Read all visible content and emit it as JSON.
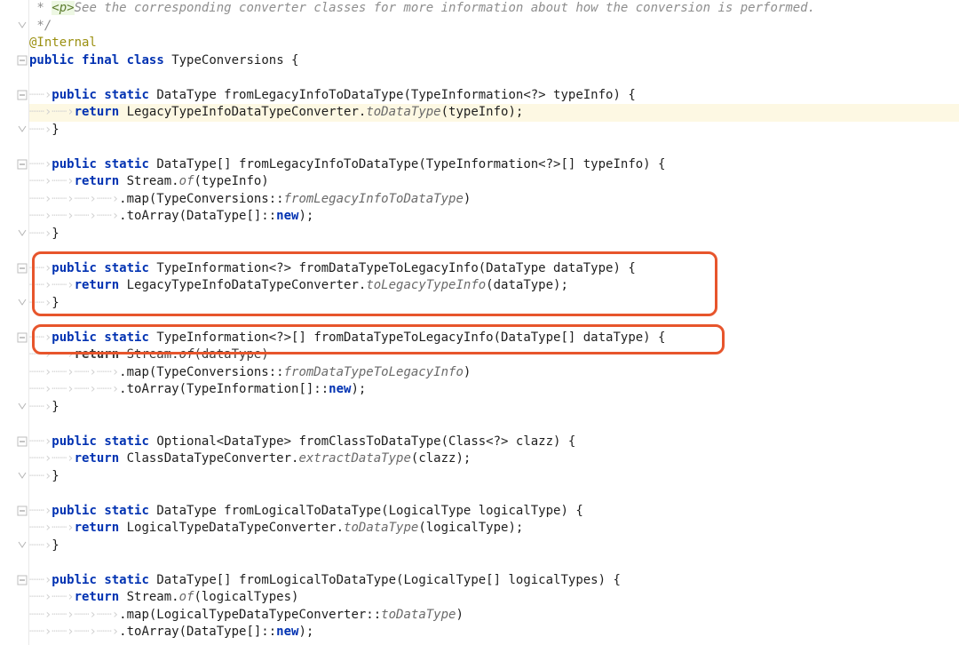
{
  "code": {
    "l01_pre": " * ",
    "l01_tag": "<p>",
    "l01_rest": "See the corresponding converter classes for more information about how the conversion is performed.",
    "l02": " */",
    "l03": "@Internal",
    "l04_a": "public",
    "l04_b": "final",
    "l04_c": "class",
    "l04_d": " TypeConversions {",
    "l05": "",
    "l06_a": "public",
    "l06_b": "static",
    "l06_c": " DataType fromLegacyInfoToDataType(TypeInformation<?> typeInfo) {",
    "l07_a": "return",
    "l07_b": " LegacyTypeInfoDataTypeConverter.",
    "l07_c": "toDataType",
    "l07_d": "(typeInfo);",
    "l08": "}",
    "l09": "",
    "l10_a": "public",
    "l10_b": "static",
    "l10_c": " DataType[] fromLegacyInfoToDataType(TypeInformation<?>[] typeInfo) {",
    "l11_a": "return",
    "l11_b": " Stream.",
    "l11_c": "of",
    "l11_d": "(typeInfo)",
    "l12_a": ".map(TypeConversions::",
    "l12_b": "fromLegacyInfoToDataType",
    "l12_c": ")",
    "l13_a": ".toArray(DataType[]::",
    "l13_b": "new",
    "l13_c": ");",
    "l14": "}",
    "l15": "",
    "l16_a": "public",
    "l16_b": "static",
    "l16_c": " TypeInformation<?> fromDataTypeToLegacyInfo(DataType dataType) {",
    "l17_a": "return",
    "l17_b": " LegacyTypeInfoDataTypeConverter.",
    "l17_c": "toLegacyTypeInfo",
    "l17_d": "(dataType);",
    "l18": "}",
    "l19": "",
    "l20_a": "public",
    "l20_b": "static",
    "l20_c": " TypeInformation<?>[] fromDataTypeToLegacyInfo(DataType[] dataType) {",
    "l21_a": "return",
    "l21_b": " Stream.",
    "l21_c": "of",
    "l21_d": "(dataType)",
    "l22_a": ".map(TypeConversions::",
    "l22_b": "fromDataTypeToLegacyInfo",
    "l22_c": ")",
    "l23_a": ".toArray(TypeInformation[]::",
    "l23_b": "new",
    "l23_c": ");",
    "l24": "}",
    "l25": "",
    "l26_a": "public",
    "l26_b": "static",
    "l26_c": " Optional<DataType> fromClassToDataType(Class<?> clazz) {",
    "l27_a": "return",
    "l27_b": " ClassDataTypeConverter.",
    "l27_c": "extractDataType",
    "l27_d": "(clazz);",
    "l28": "}",
    "l29": "",
    "l30_a": "public",
    "l30_b": "static",
    "l30_c": " DataType fromLogicalToDataType(LogicalType logicalType) {",
    "l31_a": "return",
    "l31_b": " LogicalTypeDataTypeConverter.",
    "l31_c": "toDataType",
    "l31_d": "(logicalType);",
    "l32": "}",
    "l33": "",
    "l34_a": "public",
    "l34_b": "static",
    "l34_c": " DataType[] fromLogicalToDataType(LogicalType[] logicalTypes) {",
    "l35_a": "return",
    "l35_b": " Stream.",
    "l35_c": "of",
    "l35_d": "(logicalTypes)",
    "l36_a": ".map(LogicalTypeDataTypeConverter::",
    "l36_b": "toDataType",
    "l36_c": ")",
    "l37_a": ".toArray(DataType[]::",
    "l37_b": "new",
    "l37_c": ");"
  },
  "ws": {
    "i1": "┈┈›",
    "i2": "┈┈›┈┈›",
    "i3": "┈┈›┈┈›┈┈›┈┈›"
  },
  "colors": {
    "highlight_box": "#e7552c",
    "line_highlight": "#fdf8e3",
    "keyword": "#0132b2",
    "annotation": "#9b9011"
  }
}
